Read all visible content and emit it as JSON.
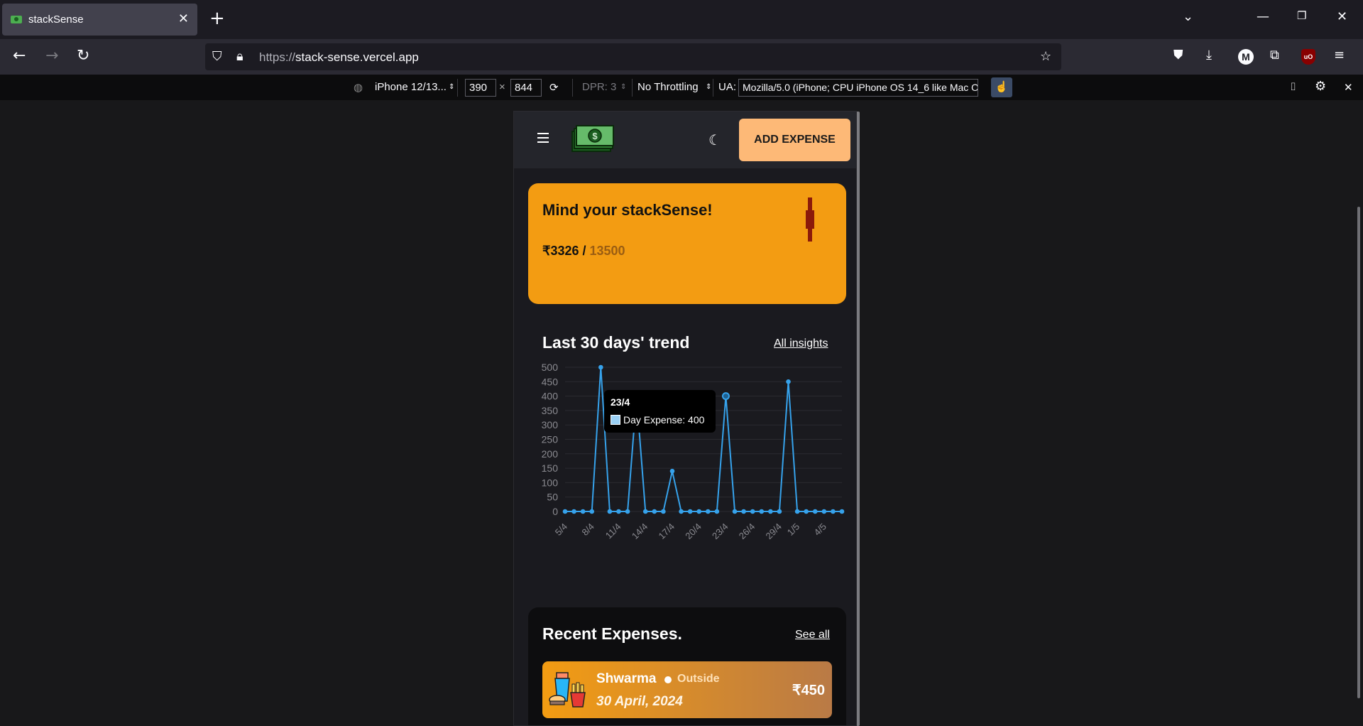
{
  "browser": {
    "tab_title": "stackSense",
    "url_protocol": "https://",
    "url_host": "stack-sense.vercel.app"
  },
  "rdm": {
    "device": "iPhone 12/13...",
    "width": "390",
    "times": "×",
    "height": "844",
    "dpr": "DPR: 3",
    "throttling": "No Throttling",
    "ua_label": "UA:",
    "ua_value": "Mozilla/5.0 (iPhone; CPU iPhone OS 14_6 like Mac O"
  },
  "app": {
    "add_expense": "ADD EXPENSE",
    "hero_title": "Mind your stackSense!",
    "spent": "₹3326",
    "slash": " / ",
    "budget": "13500",
    "trend_title": "Last 30 days' trend",
    "insights_link": "All insights",
    "recent_title": "Recent Expenses.",
    "see_all": "See all",
    "expense": {
      "name": "Shwarma",
      "category": "Outside",
      "date": "30 April, 2024",
      "amount": "₹450"
    },
    "tooltip": {
      "date": "23/4",
      "label": "Day Expense: 400"
    },
    "colors": {
      "accent": "#f39c12",
      "button": "#fdb977",
      "line": "#36a2eb"
    }
  },
  "chart_data": {
    "type": "line",
    "x": [
      "5/4",
      "6/4",
      "7/4",
      "8/4",
      "9/4",
      "10/4",
      "11/4",
      "12/4",
      "13/4",
      "14/4",
      "15/4",
      "16/4",
      "17/4",
      "18/4",
      "19/4",
      "20/4",
      "21/4",
      "22/4",
      "23/4",
      "24/4",
      "25/4",
      "26/4",
      "27/4",
      "28/4",
      "29/4",
      "30/4",
      "1/5",
      "2/5",
      "3/5",
      "4/5",
      "5/5",
      "6/5"
    ],
    "x_tick_labels": [
      "5/4",
      "8/4",
      "11/4",
      "14/4",
      "17/4",
      "20/4",
      "23/4",
      "26/4",
      "29/4",
      "1/5",
      "4/5"
    ],
    "series": [
      {
        "values": [
          0,
          0,
          0,
          0,
          500,
          0,
          0,
          0,
          400,
          0,
          0,
          0,
          140,
          0,
          0,
          0,
          0,
          0,
          400,
          0,
          0,
          0,
          0,
          0,
          0,
          450,
          0,
          0,
          0,
          0,
          0,
          0
        ]
      }
    ],
    "y_ticks": [
      0,
      50,
      100,
      150,
      200,
      250,
      300,
      350,
      400,
      450,
      500
    ],
    "ylim": [
      0,
      500
    ],
    "grid": true
  }
}
